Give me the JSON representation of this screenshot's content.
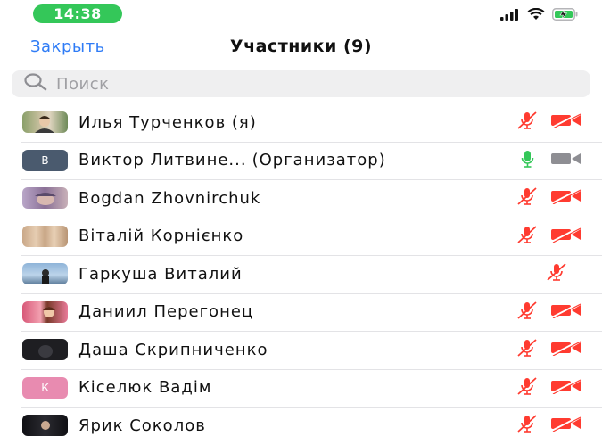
{
  "status_bar": {
    "time": "14:38",
    "icons": [
      "cellular-signal-icon",
      "wifi-icon",
      "battery-charging-icon"
    ]
  },
  "nav": {
    "close_label": "Закрыть",
    "title": "Участники (9)"
  },
  "search": {
    "placeholder": "Поиск"
  },
  "participants": [
    {
      "name": "Илья Турченков (я)",
      "role": "",
      "avatar": "photo",
      "mic": "muted",
      "video": "off"
    },
    {
      "name": "Виктор Литвине...",
      "role": "(Организатор)",
      "avatar": "initial",
      "initial": "В",
      "avatar_color": "#4a5a6e",
      "mic": "active",
      "video": "on"
    },
    {
      "name": "Bogdan Zhovnirchuk",
      "role": "",
      "avatar": "photo",
      "mic": "muted",
      "video": "off"
    },
    {
      "name": "Віталій Корнієнко",
      "role": "",
      "avatar": "photo",
      "mic": "muted",
      "video": "off"
    },
    {
      "name": "Гаркуша Виталий",
      "role": "",
      "avatar": "photo",
      "mic": "muted",
      "video": "none"
    },
    {
      "name": "Даниил Перегонец",
      "role": "",
      "avatar": "photo",
      "mic": "muted",
      "video": "off"
    },
    {
      "name": "Даша Скрипниченко",
      "role": "",
      "avatar": "photo",
      "mic": "muted",
      "video": "off"
    },
    {
      "name": "Кіселюк Вадім",
      "role": "",
      "avatar": "initial",
      "initial": "К",
      "avatar_color": "#e88bb0",
      "mic": "muted",
      "video": "off"
    },
    {
      "name": "Ярик Соколов",
      "role": "",
      "avatar": "photo",
      "mic": "muted",
      "video": "off"
    }
  ],
  "colors": {
    "accent": "#2f7cf6",
    "muted_red": "#ff3b30",
    "active_green": "#34c759",
    "video_gray": "#8e8e93",
    "status_pill": "#34c759"
  }
}
